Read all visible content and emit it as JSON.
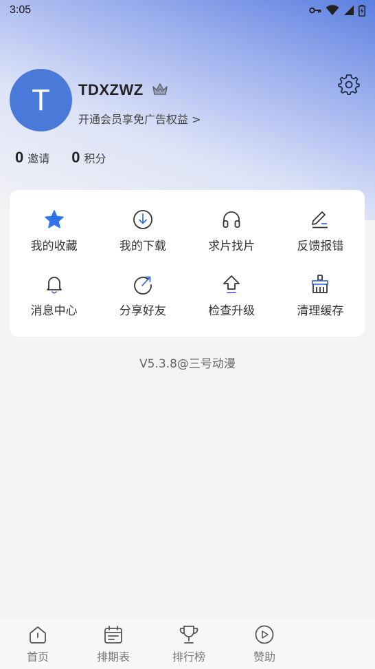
{
  "status_bar": {
    "time": "3:05"
  },
  "profile": {
    "avatar_letter": "T",
    "username": "TDXZWZ",
    "vip_link": "开通会员享免广告权益 >"
  },
  "stats": [
    {
      "value": "0",
      "label": "邀请"
    },
    {
      "value": "0",
      "label": "积分"
    }
  ],
  "menu": [
    {
      "label": "我的收藏",
      "icon": "star-icon"
    },
    {
      "label": "我的下载",
      "icon": "download-icon"
    },
    {
      "label": "求片找片",
      "icon": "headphones-icon"
    },
    {
      "label": "反馈报错",
      "icon": "edit-icon"
    },
    {
      "label": "消息中心",
      "icon": "bell-icon"
    },
    {
      "label": "分享好友",
      "icon": "share-icon"
    },
    {
      "label": "检查升级",
      "icon": "upgrade-icon"
    },
    {
      "label": "清理缓存",
      "icon": "broom-icon"
    }
  ],
  "version": "V5.3.8@三号动漫",
  "bottom_nav": [
    {
      "label": "首页",
      "icon": "home-icon"
    },
    {
      "label": "排期表",
      "icon": "calendar-icon"
    },
    {
      "label": "排行榜",
      "icon": "trophy-icon"
    },
    {
      "label": "赞助",
      "icon": "play-circle-icon"
    }
  ],
  "colors": {
    "accent": "#4a7ad9",
    "star": "#2f74e8",
    "icon_stroke": "#333333",
    "icon_accent": "#3f6fd8"
  }
}
